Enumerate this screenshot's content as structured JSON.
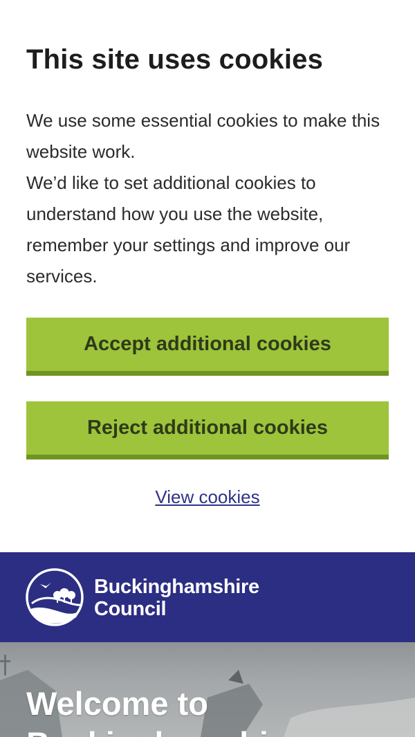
{
  "cookie_banner": {
    "title": "This site uses cookies",
    "paragraph_1": "We use some essential cookies to make this website work.",
    "paragraph_2": "We’d like to set additional cookies to understand how you use the website, remember your settings and improve our services.",
    "accept_label": "Accept additional cookies",
    "reject_label": "Reject additional cookies",
    "view_link": "View cookies"
  },
  "header": {
    "logo_line_1": "Buckinghamshire",
    "logo_line_2": "Council",
    "logo_icon": "council-logo-icon"
  },
  "hero": {
    "title_line_1": "Welcome to",
    "title_line_2": "Buckinghamshire"
  },
  "colors": {
    "button_green": "#9dc43a",
    "button_green_border": "#6f9422",
    "header_blue": "#2c2e83",
    "link_blue": "#2e3388"
  }
}
